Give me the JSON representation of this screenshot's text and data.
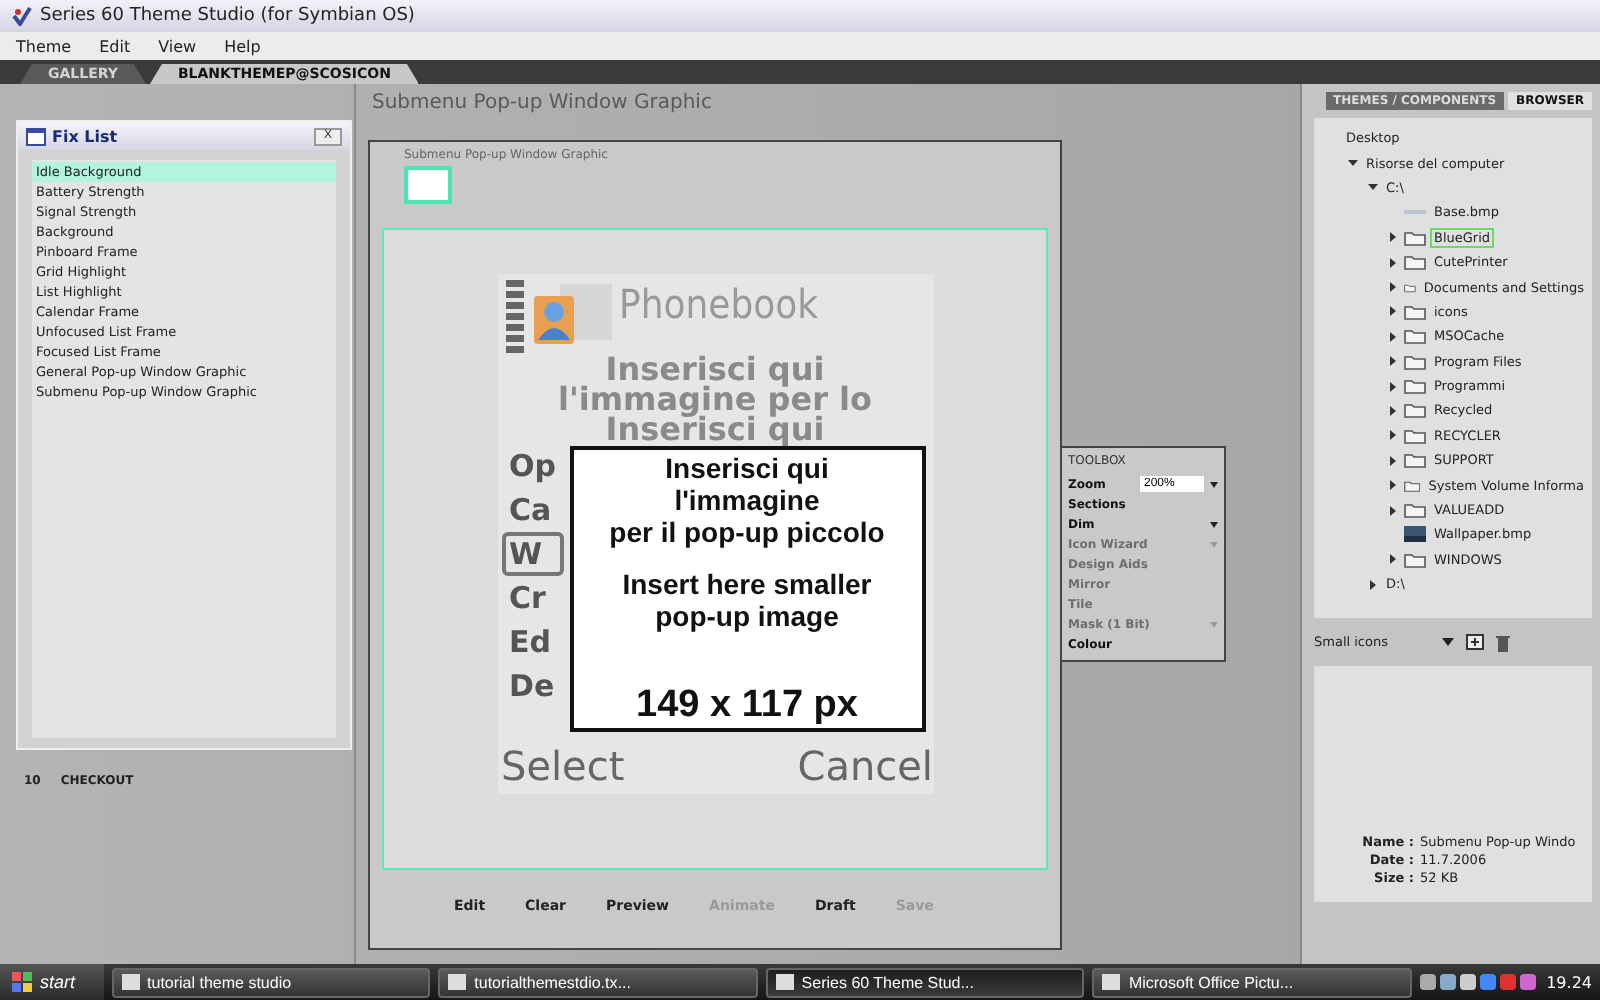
{
  "window": {
    "title": "Series 60 Theme Studio (for Symbian OS)"
  },
  "menu": [
    "Theme",
    "Edit",
    "View",
    "Help"
  ],
  "doc_tabs": [
    {
      "label": "GALLERY",
      "selected": false
    },
    {
      "label": "BLANKTHEMEP@SCOSICON",
      "selected": true
    }
  ],
  "fix_list": {
    "title": "Fix List",
    "close": "X",
    "items": [
      {
        "label": "Idle Background",
        "selected": true
      },
      {
        "label": "Battery Strength",
        "selected": false
      },
      {
        "label": "Signal Strength",
        "selected": false
      },
      {
        "label": "Background",
        "selected": false
      },
      {
        "label": "Pinboard Frame",
        "selected": false
      },
      {
        "label": "Grid Highlight",
        "selected": false
      },
      {
        "label": "List Highlight",
        "selected": false
      },
      {
        "label": "Calendar Frame",
        "selected": false
      },
      {
        "label": "Unfocused List Frame",
        "selected": false
      },
      {
        "label": "Focused List Frame",
        "selected": false
      },
      {
        "label": "General Pop-up Window Graphic",
        "selected": false
      },
      {
        "label": "Submenu Pop-up Window Graphic",
        "selected": false
      }
    ]
  },
  "checkout": {
    "count": "10",
    "label": "CHECKOUT"
  },
  "editor": {
    "title": "Submenu Pop-up Window Graphic",
    "thumb_label": "Submenu Pop-up Window Graphic",
    "phone": {
      "header": "Phonebook",
      "back_lines": [
        "Inserisci qui",
        "l'immagine per lo",
        "Inserisci qui"
      ],
      "menu": [
        {
          "label": "Op",
          "selected": false
        },
        {
          "label": "Ca",
          "selected": false
        },
        {
          "label": "W",
          "selected": true
        },
        {
          "label": "Cr",
          "selected": false
        },
        {
          "label": "Ed",
          "selected": false
        },
        {
          "label": "De",
          "selected": false
        }
      ],
      "left_soft": "Select",
      "right_soft": "Cancel",
      "popup": {
        "lines": [
          "Inserisci qui",
          "l'immagine",
          "per il pop-up piccolo"
        ],
        "lines_en": [
          "Insert here smaller",
          "pop-up image"
        ],
        "size": "149 x 117 px"
      }
    },
    "buttons": [
      {
        "label": "Edit",
        "disabled": false
      },
      {
        "label": "Clear",
        "disabled": false
      },
      {
        "label": "Preview",
        "disabled": false
      },
      {
        "label": "Animate",
        "disabled": true
      },
      {
        "label": "Draft",
        "disabled": false
      },
      {
        "label": "Save",
        "disabled": true
      }
    ]
  },
  "toolbox": {
    "title": "TOOLBOX",
    "rows": [
      {
        "label": "Zoom",
        "kind": "field",
        "value": "200%",
        "disabled": false
      },
      {
        "label": "Sections",
        "kind": "plain",
        "disabled": false
      },
      {
        "label": "Dim",
        "kind": "dropdown",
        "disabled": false
      },
      {
        "label": "Icon Wizard",
        "kind": "dropdown",
        "disabled": true
      },
      {
        "label": "Design Aids",
        "kind": "plain",
        "disabled": true
      },
      {
        "label": "Mirror",
        "kind": "plain",
        "disabled": true
      },
      {
        "label": "Tile",
        "kind": "plain",
        "disabled": true
      },
      {
        "label": "Mask (1 Bit)",
        "kind": "dropdown",
        "disabled": true
      },
      {
        "label": "Colour",
        "kind": "plain",
        "disabled": false
      }
    ]
  },
  "side_tabs": [
    {
      "label": "THEMES / COMPONENTS",
      "selected": false
    },
    {
      "label": "BROWSER",
      "selected": true
    }
  ],
  "tree": [
    {
      "label": "Desktop",
      "selected": false,
      "children": [
        {
          "label": "Risorse del computer",
          "expanded": true,
          "selected": false,
          "children": [
            {
              "label": "C:\\",
              "expanded": true,
              "selected": false,
              "children": [
                {
                  "label": "Base.bmp",
                  "kind": "file",
                  "selected": false
                },
                {
                  "label": "BlueGrid",
                  "kind": "folder",
                  "expanded": false,
                  "selected": true
                },
                {
                  "label": "CutePrinter",
                  "kind": "folder",
                  "expanded": false,
                  "selected": false
                },
                {
                  "label": "Documents and Settings",
                  "kind": "folder",
                  "expanded": false,
                  "selected": false
                },
                {
                  "label": "icons",
                  "kind": "folder",
                  "expanded": false,
                  "selected": false
                },
                {
                  "label": "MSOCache",
                  "kind": "folder",
                  "expanded": false,
                  "selected": false
                },
                {
                  "label": "Program Files",
                  "kind": "folder",
                  "expanded": false,
                  "selected": false
                },
                {
                  "label": "Programmi",
                  "kind": "folder",
                  "expanded": false,
                  "selected": false
                },
                {
                  "label": "Recycled",
                  "kind": "folder",
                  "expanded": false,
                  "selected": false
                },
                {
                  "label": "RECYCLER",
                  "kind": "folder",
                  "expanded": false,
                  "selected": false
                },
                {
                  "label": "SUPPORT",
                  "kind": "folder",
                  "expanded": false,
                  "selected": false
                },
                {
                  "label": "System Volume Informa",
                  "kind": "folder",
                  "expanded": false,
                  "selected": false
                },
                {
                  "label": "VALUEADD",
                  "kind": "folder",
                  "expanded": false,
                  "selected": false
                },
                {
                  "label": "Wallpaper.bmp",
                  "kind": "image",
                  "selected": false
                },
                {
                  "label": "WINDOWS",
                  "kind": "folder",
                  "expanded": false,
                  "selected": false
                }
              ]
            },
            {
              "label": "D:\\",
              "expanded": false,
              "selected": false
            }
          ]
        }
      ]
    }
  ],
  "view_select": {
    "value": "Small icons"
  },
  "info": [
    {
      "label": "Name :",
      "value": "Submenu Pop-up Windo"
    },
    {
      "label": "Date :",
      "value": "11.7.2006"
    },
    {
      "label": "Size :",
      "value": "52 KB"
    }
  ],
  "taskbar": {
    "start": "start",
    "tasks": [
      {
        "label": "tutorial theme studio",
        "selected": false
      },
      {
        "label": "tutorialthemestdio.tx...",
        "selected": false
      },
      {
        "label": "Series 60 Theme Stud...",
        "selected": true
      },
      {
        "label": "Microsoft Office Pictu...",
        "selected": false
      }
    ],
    "clock": "19.24"
  }
}
